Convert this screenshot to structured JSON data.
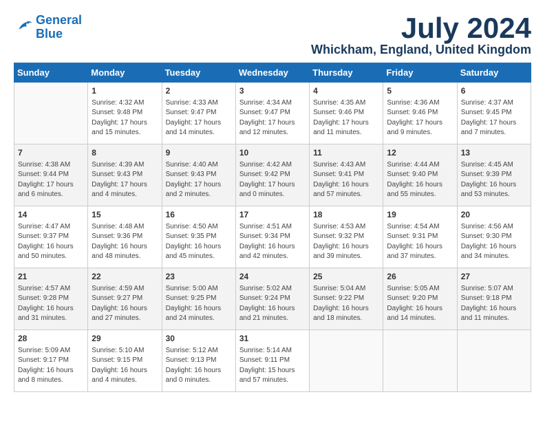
{
  "header": {
    "logo_line1": "General",
    "logo_line2": "Blue",
    "month": "July 2024",
    "location": "Whickham, England, United Kingdom"
  },
  "columns": [
    "Sunday",
    "Monday",
    "Tuesday",
    "Wednesday",
    "Thursday",
    "Friday",
    "Saturday"
  ],
  "weeks": [
    [
      {
        "day": "",
        "info": ""
      },
      {
        "day": "1",
        "info": "Sunrise: 4:32 AM\nSunset: 9:48 PM\nDaylight: 17 hours\nand 15 minutes."
      },
      {
        "day": "2",
        "info": "Sunrise: 4:33 AM\nSunset: 9:47 PM\nDaylight: 17 hours\nand 14 minutes."
      },
      {
        "day": "3",
        "info": "Sunrise: 4:34 AM\nSunset: 9:47 PM\nDaylight: 17 hours\nand 12 minutes."
      },
      {
        "day": "4",
        "info": "Sunrise: 4:35 AM\nSunset: 9:46 PM\nDaylight: 17 hours\nand 11 minutes."
      },
      {
        "day": "5",
        "info": "Sunrise: 4:36 AM\nSunset: 9:46 PM\nDaylight: 17 hours\nand 9 minutes."
      },
      {
        "day": "6",
        "info": "Sunrise: 4:37 AM\nSunset: 9:45 PM\nDaylight: 17 hours\nand 7 minutes."
      }
    ],
    [
      {
        "day": "7",
        "info": "Sunrise: 4:38 AM\nSunset: 9:44 PM\nDaylight: 17 hours\nand 6 minutes."
      },
      {
        "day": "8",
        "info": "Sunrise: 4:39 AM\nSunset: 9:43 PM\nDaylight: 17 hours\nand 4 minutes."
      },
      {
        "day": "9",
        "info": "Sunrise: 4:40 AM\nSunset: 9:43 PM\nDaylight: 17 hours\nand 2 minutes."
      },
      {
        "day": "10",
        "info": "Sunrise: 4:42 AM\nSunset: 9:42 PM\nDaylight: 17 hours\nand 0 minutes."
      },
      {
        "day": "11",
        "info": "Sunrise: 4:43 AM\nSunset: 9:41 PM\nDaylight: 16 hours\nand 57 minutes."
      },
      {
        "day": "12",
        "info": "Sunrise: 4:44 AM\nSunset: 9:40 PM\nDaylight: 16 hours\nand 55 minutes."
      },
      {
        "day": "13",
        "info": "Sunrise: 4:45 AM\nSunset: 9:39 PM\nDaylight: 16 hours\nand 53 minutes."
      }
    ],
    [
      {
        "day": "14",
        "info": "Sunrise: 4:47 AM\nSunset: 9:37 PM\nDaylight: 16 hours\nand 50 minutes."
      },
      {
        "day": "15",
        "info": "Sunrise: 4:48 AM\nSunset: 9:36 PM\nDaylight: 16 hours\nand 48 minutes."
      },
      {
        "day": "16",
        "info": "Sunrise: 4:50 AM\nSunset: 9:35 PM\nDaylight: 16 hours\nand 45 minutes."
      },
      {
        "day": "17",
        "info": "Sunrise: 4:51 AM\nSunset: 9:34 PM\nDaylight: 16 hours\nand 42 minutes."
      },
      {
        "day": "18",
        "info": "Sunrise: 4:53 AM\nSunset: 9:32 PM\nDaylight: 16 hours\nand 39 minutes."
      },
      {
        "day": "19",
        "info": "Sunrise: 4:54 AM\nSunset: 9:31 PM\nDaylight: 16 hours\nand 37 minutes."
      },
      {
        "day": "20",
        "info": "Sunrise: 4:56 AM\nSunset: 9:30 PM\nDaylight: 16 hours\nand 34 minutes."
      }
    ],
    [
      {
        "day": "21",
        "info": "Sunrise: 4:57 AM\nSunset: 9:28 PM\nDaylight: 16 hours\nand 31 minutes."
      },
      {
        "day": "22",
        "info": "Sunrise: 4:59 AM\nSunset: 9:27 PM\nDaylight: 16 hours\nand 27 minutes."
      },
      {
        "day": "23",
        "info": "Sunrise: 5:00 AM\nSunset: 9:25 PM\nDaylight: 16 hours\nand 24 minutes."
      },
      {
        "day": "24",
        "info": "Sunrise: 5:02 AM\nSunset: 9:24 PM\nDaylight: 16 hours\nand 21 minutes."
      },
      {
        "day": "25",
        "info": "Sunrise: 5:04 AM\nSunset: 9:22 PM\nDaylight: 16 hours\nand 18 minutes."
      },
      {
        "day": "26",
        "info": "Sunrise: 5:05 AM\nSunset: 9:20 PM\nDaylight: 16 hours\nand 14 minutes."
      },
      {
        "day": "27",
        "info": "Sunrise: 5:07 AM\nSunset: 9:18 PM\nDaylight: 16 hours\nand 11 minutes."
      }
    ],
    [
      {
        "day": "28",
        "info": "Sunrise: 5:09 AM\nSunset: 9:17 PM\nDaylight: 16 hours\nand 8 minutes."
      },
      {
        "day": "29",
        "info": "Sunrise: 5:10 AM\nSunset: 9:15 PM\nDaylight: 16 hours\nand 4 minutes."
      },
      {
        "day": "30",
        "info": "Sunrise: 5:12 AM\nSunset: 9:13 PM\nDaylight: 16 hours\nand 0 minutes."
      },
      {
        "day": "31",
        "info": "Sunrise: 5:14 AM\nSunset: 9:11 PM\nDaylight: 15 hours\nand 57 minutes."
      },
      {
        "day": "",
        "info": ""
      },
      {
        "day": "",
        "info": ""
      },
      {
        "day": "",
        "info": ""
      }
    ]
  ]
}
